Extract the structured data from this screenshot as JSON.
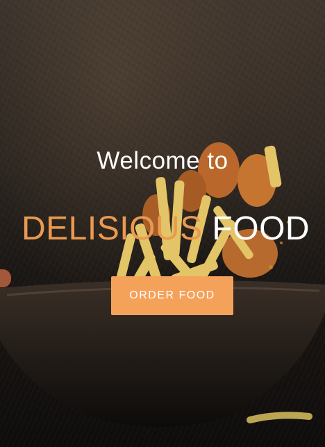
{
  "hero": {
    "welcome_text": "Welcome to",
    "brand_accent": "DELISIOUS",
    "brand_rest": "FOOD",
    "order_button_label": "ORDER FOOD"
  },
  "colors": {
    "accent": "#ea9a4f",
    "button_background": "#f4a15a",
    "text": "#ffffff",
    "background": "#1a1613"
  }
}
